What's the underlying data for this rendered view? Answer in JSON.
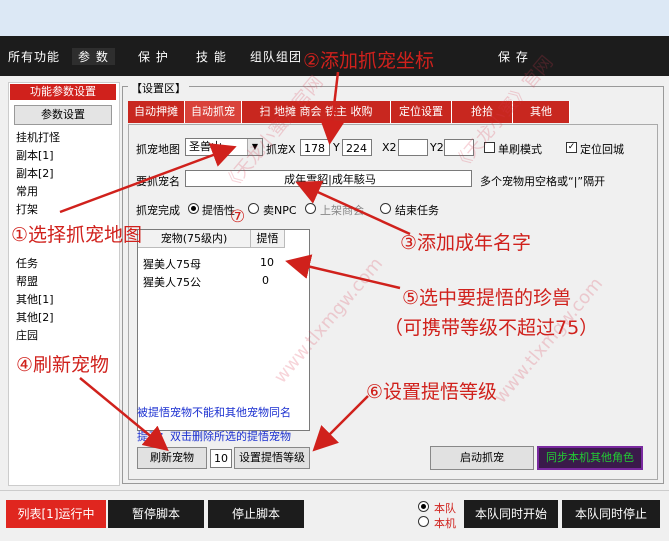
{
  "menu": {
    "items": [
      "所有功能",
      "参 数",
      "保 护",
      "技 能",
      "组队组团",
      "保 存"
    ]
  },
  "left": {
    "header": "功能参数设置",
    "button": "参数设置",
    "items": [
      "挂机打怪",
      "副本[1]",
      "副本[2]",
      "常用",
      "打架",
      "任务",
      "帮盟",
      "其他[1]",
      "其他[2]",
      "庄园"
    ]
  },
  "group": {
    "label": "【设置区】"
  },
  "tabs": [
    "自动押摊",
    "自动抓宠",
    "扫 地摊 商会 铁主 收购",
    "定位设置",
    "抢拾",
    "其他"
  ],
  "form": {
    "map_label": "抓宠地图",
    "map_value": "圣兽山",
    "coord_prefix": "抓宠X",
    "x1": "178",
    "y_label": "Y",
    "y1": "224",
    "x2_label": "X2",
    "y2_label": "Y2",
    "single_brush": "单刷模式",
    "locate_return": "定位回城",
    "name_label": "要抓宠名",
    "name_value": "成年雪貂|成年駭马",
    "name_hint": "多个宠物用空格或“|”隔开",
    "done_label": "抓宠完成",
    "radio_options": [
      "提悟性",
      "卖NPC",
      "上架商会",
      "结束任务"
    ]
  },
  "list": {
    "headers": [
      "宠物(75级内)",
      "提悟"
    ],
    "rows": [
      {
        "name": "猩美人75母",
        "value": "10"
      },
      {
        "name": "猩美人75公",
        "value": "0"
      }
    ]
  },
  "notes": {
    "line1": "被提悟宠物不能和其他宠物同名",
    "line2": "提示：双击删除所选的提悟宠物"
  },
  "buttons": {
    "refresh": "刷新宠物",
    "level_value": "10",
    "set_level": "设置提悟等级",
    "start_catch": "启动抓宠",
    "sync": "同步本机其他角色"
  },
  "bottom": {
    "run": "列表[1]运行中",
    "pause": "暂停脚本",
    "stop": "停止脚本",
    "team_radio": "本队",
    "local_radio": "本机",
    "team_start": "本队同时开始",
    "team_stop": "本队同时停止"
  },
  "annotations": {
    "a1": "①选择抓宠地图",
    "a2": "②添加抓宠坐标",
    "a3": "③添加成年名字",
    "a4": "④刷新宠物",
    "a5": "⑤选中要提悟的珍兽",
    "a5b": "（可携带等级不超过75）",
    "a6": "⑥设置提悟等级",
    "a7": "⑦"
  },
  "watermark": {
    "text": "《天龙小蜜》官网",
    "site": "www.tlxmgw.com"
  },
  "colors": {
    "accent_red": "#d0211c",
    "dark": "#1c1c1c",
    "note_blue": "#1a2fd0",
    "sync_green": "#22cc33"
  }
}
